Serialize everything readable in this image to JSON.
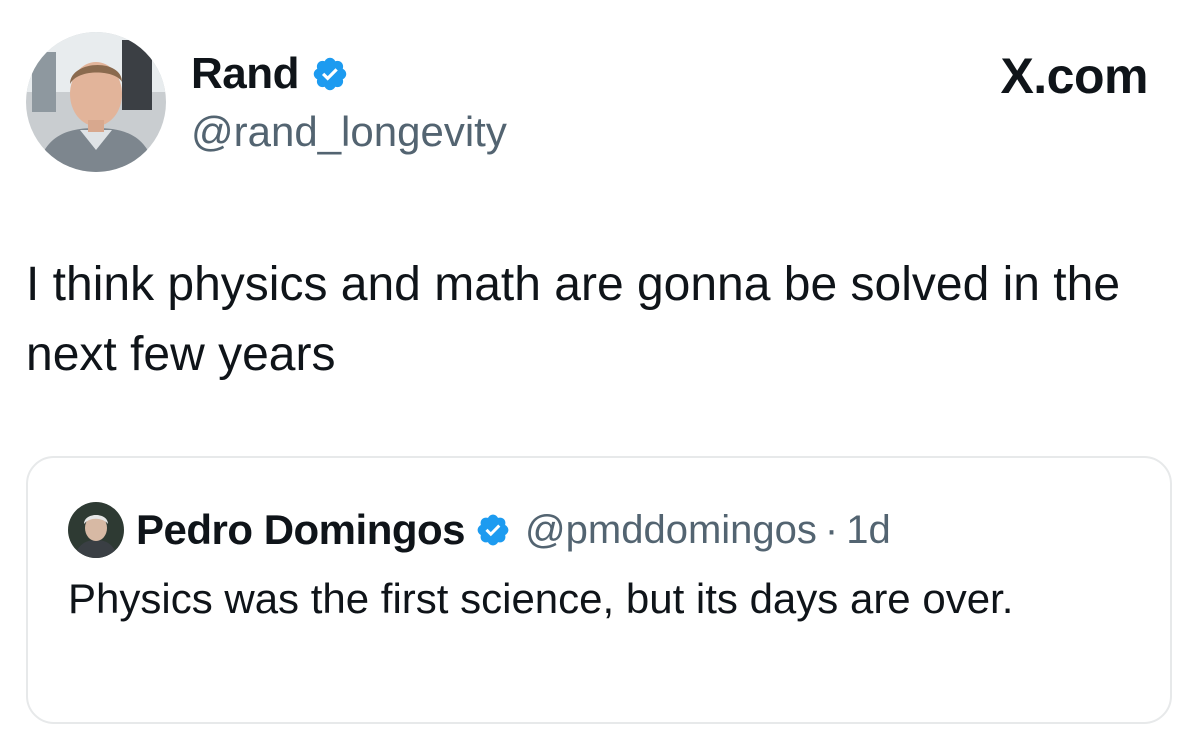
{
  "post": {
    "author": {
      "name": "Rand",
      "handle": "@rand_longevity",
      "verified": true,
      "avatar_icon": "profile-photo"
    },
    "brand": "X.com",
    "text": "I think physics and math are gonna be solved in the next few years",
    "quoted_post": {
      "author": {
        "name": "Pedro Domingos",
        "handle": "@pmddomingos",
        "verified": true,
        "avatar_icon": "profile-photo"
      },
      "separator": "·",
      "time": "1d",
      "text": "Physics was the first science, but its days are over."
    }
  },
  "colors": {
    "text_primary": "#0f1419",
    "text_secondary": "#536471",
    "verified_blue": "#1d9bf0",
    "card_border": "#e7e9ea",
    "background": "#ffffff"
  }
}
